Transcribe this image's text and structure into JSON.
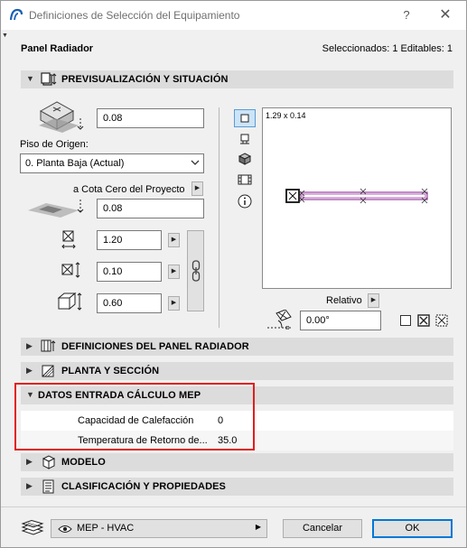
{
  "window": {
    "title": "Definiciones de Selección del Equipamiento",
    "help": "?",
    "close": "✕"
  },
  "header": {
    "name": "Panel Radiador",
    "selection": "Seleccionados: 1 Editables: 1"
  },
  "sections": {
    "preview": "PREVISUALIZACIÓN Y SITUACIÓN",
    "radiator": "DEFINICIONES DEL PANEL RADIADOR",
    "floor_plan": "PLANTA Y SECCIÓN",
    "mep": "DATOS ENTRADA CÁLCULO MEP",
    "model": "MODELO",
    "classification": "CLASIFICACIÓN Y PROPIEDADES"
  },
  "placement": {
    "top_value": "0.08",
    "home_story_label": "Piso de Origen:",
    "home_story_value": "0. Planta Baja (Actual)",
    "ref_level_label": "a Cota Cero del Proyecto",
    "elevation_value": "0.08",
    "width_value": "1.20",
    "depth_value": "0.10",
    "height_value": "0.60"
  },
  "preview_box": {
    "size_label": "1.29 x 0.14",
    "relative_label": "Relativo",
    "angle_value": "0.00°"
  },
  "mep": {
    "rows": [
      {
        "key": "Capacidad de Calefacción",
        "value": "0"
      },
      {
        "key": "Temperatura de Retorno de...",
        "value": "35.0"
      }
    ]
  },
  "footer": {
    "layer": "MEP - HVAC",
    "cancel": "Cancelar",
    "ok": "OK"
  },
  "colors": {
    "highlight": "#e21d1d",
    "accent": "#0078d7",
    "radiator": "#9b3fa3"
  }
}
